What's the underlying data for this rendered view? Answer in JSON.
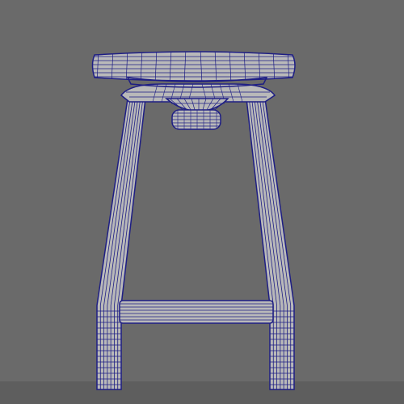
{
  "viewport": {
    "background_color": "#6a6a6a",
    "ground_color": "#5e5e5e",
    "shaded_color": "#b9b9b9",
    "wire_color": "#1e1e84",
    "wire_light_color": "#3a3aa0"
  },
  "model": {
    "object": "stool",
    "display_mode": "wireframe-on-shaded"
  }
}
